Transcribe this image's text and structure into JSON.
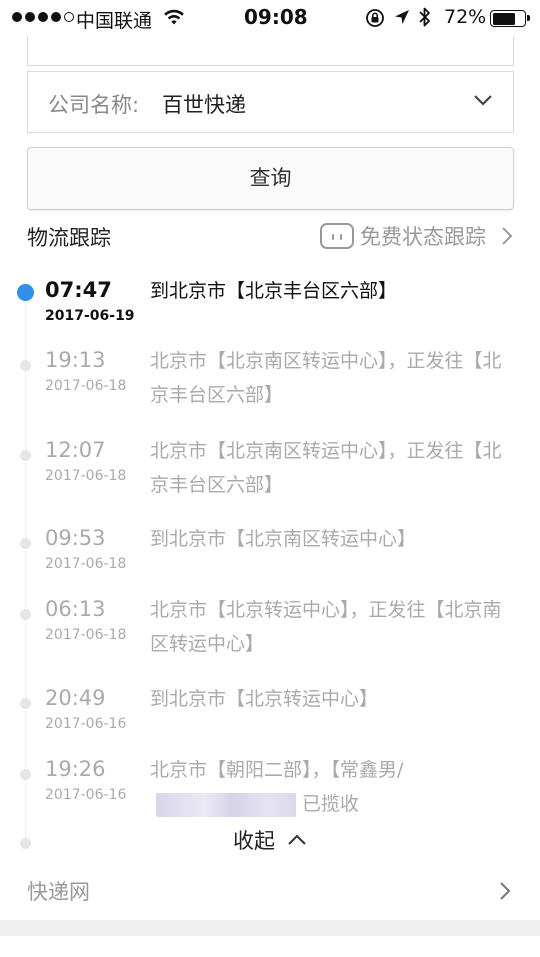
{
  "status_bar": {
    "carrier": "中国联通",
    "time": "09:08",
    "battery_percent": "72%",
    "battery_level": 0.72
  },
  "form": {
    "company_label": "公司名称:",
    "company_value": "百世快递",
    "query_button": "查询"
  },
  "tracking": {
    "section_title": "物流跟踪",
    "free_tracking_label": "免费状态跟踪",
    "events": [
      {
        "time": "07:47",
        "date": "2017-06-19",
        "desc": "到北京市【北京丰台区六部】"
      },
      {
        "time": "19:13",
        "date": "2017-06-18",
        "desc": "北京市【北京南区转运中心】，正发往【北京丰台区六部】"
      },
      {
        "time": "12:07",
        "date": "2017-06-18",
        "desc": "北京市【北京南区转运中心】，正发往【北京丰台区六部】"
      },
      {
        "time": "09:53",
        "date": "2017-06-18",
        "desc": "到北京市【北京南区转运中心】"
      },
      {
        "time": "06:13",
        "date": "2017-06-18",
        "desc": "北京市【北京转运中心】，正发往【北京南区转运中心】"
      },
      {
        "time": "20:49",
        "date": "2017-06-16",
        "desc": "到北京市【北京转运中心】"
      },
      {
        "time": "19:26",
        "date": "2017-06-16",
        "desc_before": "北京市【朝阳二部】，【常鑫男/",
        "desc_after": "已揽收"
      }
    ],
    "collapse_label": "收起"
  },
  "footer": {
    "label": "快递网"
  },
  "colors": {
    "accent": "#2f8fea",
    "muted_text": "#aaaaaa",
    "border": "#dcdcdc"
  }
}
